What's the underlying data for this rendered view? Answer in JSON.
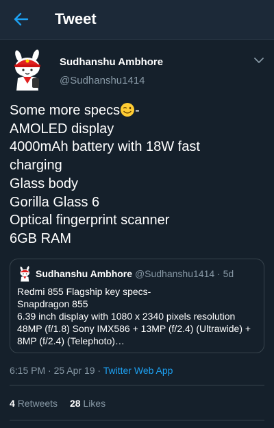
{
  "header": {
    "title": "Tweet",
    "back_icon": "back-arrow-icon"
  },
  "tweet": {
    "author_name": "Sudhanshu Ambhore",
    "author_handle": "@Sudhanshu1414",
    "lines": [
      "Some more specs",
      "AMOLED display",
      "4000mAh battery with 18W fast",
      "charging",
      "Glass body",
      "Gorilla Glass 6",
      "Optical fingerprint scanner",
      "6GB RAM"
    ],
    "first_line_suffix": "-",
    "emoji": "winking-face-emoji"
  },
  "quote": {
    "author_name": "Sudhanshu Ambhore",
    "author_handle": "@Sudhanshu1414",
    "separator": "·",
    "age": "5d",
    "lines": [
      "Redmi 855 Flagship key specs-",
      "Snapdragon 855",
      "6.39 inch display with 1080 x 2340 pixels resolution",
      "48MP (f/1.8) Sony IMX586 + 13MP (f/2.4) (Ultrawide) +",
      "8MP (f/2.4) (Telephoto)…"
    ]
  },
  "meta": {
    "time": "6:15 PM",
    "dot1": " · ",
    "date": "25 Apr 19",
    "dot2": " · ",
    "source": "Twitter Web App"
  },
  "stats": {
    "retweets_count": "4",
    "retweets_label": "Retweets",
    "likes_count": "28",
    "likes_label": "Likes"
  },
  "colors": {
    "background": "#15202b",
    "header": "#1c2938",
    "accent": "#1da1f2",
    "secondary_text": "#8899a6",
    "border": "#38444d"
  }
}
